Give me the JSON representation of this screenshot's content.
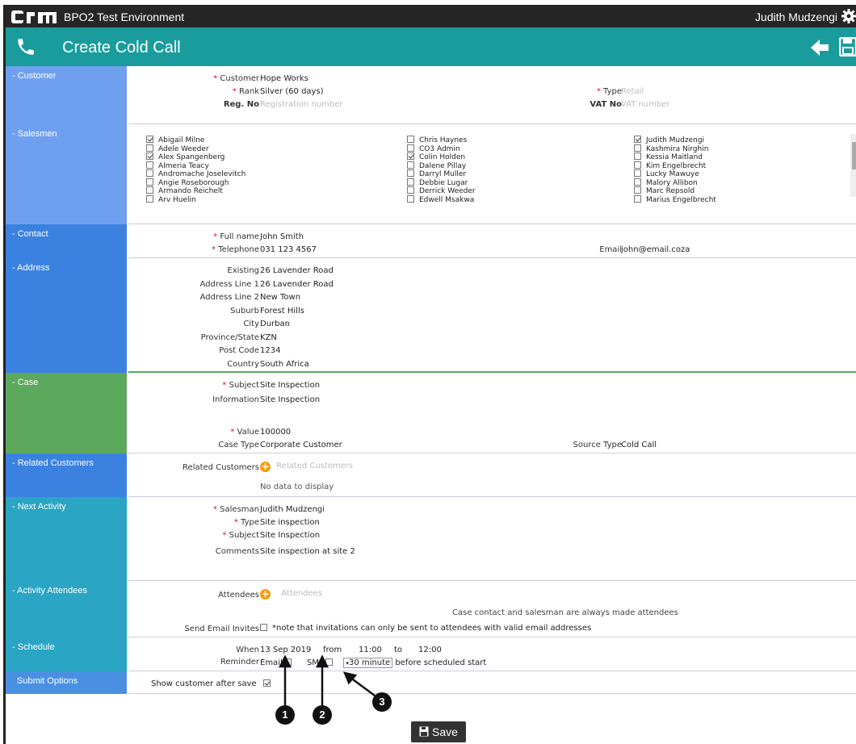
{
  "app": {
    "env_name": "BPO2 Test Environment",
    "user_name": "Judith Mudzengi",
    "page_title": "Create Cold Call"
  },
  "colors": {
    "top_bar": "#262626",
    "title_bar": "#1b9c9c",
    "section_blue": "#4a90e2",
    "section_light_blue": "#6fa0f0",
    "section_green": "#5ca85c",
    "section_teal": "#2aa5c4"
  },
  "sections": {
    "customer": "Customer",
    "salesmen": "Salesmen",
    "contact": "Contact",
    "address": "Address",
    "case": "Case",
    "related": "Related Customers",
    "next_activity": "Next Activity",
    "attendees": "Activity Attendees",
    "schedule": "Schedule",
    "submit": "Submit Options"
  },
  "customer": {
    "customer_label": "Customer",
    "customer_value": "Hope Works",
    "rank_label": "Rank",
    "rank_value": "Silver (60 days)",
    "reg_label": "Reg. No",
    "reg_placeholder": "Registration number",
    "type_label": "Type",
    "type_placeholder": "Retail",
    "vat_label": "VAT No",
    "vat_placeholder": "VAT number"
  },
  "salesmen": {
    "col1": [
      {
        "name": "Abigail Milne",
        "checked": true
      },
      {
        "name": "Adele Weeder",
        "checked": false
      },
      {
        "name": "Alex Spangenberg",
        "checked": true
      },
      {
        "name": "Almeria Teacy",
        "checked": false
      },
      {
        "name": "Andromache Joselevitch",
        "checked": false
      },
      {
        "name": "Angie Roseborough",
        "checked": false
      },
      {
        "name": "Armando Reichelt",
        "checked": false
      },
      {
        "name": "Arv Huelin",
        "checked": false
      }
    ],
    "col2": [
      {
        "name": "Chris Haynes",
        "checked": false
      },
      {
        "name": "CO3 Admin",
        "checked": false
      },
      {
        "name": "Colin Holden",
        "checked": true
      },
      {
        "name": "Dalene Pillay",
        "checked": false
      },
      {
        "name": "Darryl Muller",
        "checked": false
      },
      {
        "name": "Debbie Lugar",
        "checked": false
      },
      {
        "name": "Derrick Weeder",
        "checked": false
      },
      {
        "name": "Edwell Msakwa",
        "checked": false
      }
    ],
    "col3": [
      {
        "name": "Judith Mudzengi",
        "checked": true
      },
      {
        "name": "Kashmira Nirghin",
        "checked": false
      },
      {
        "name": "Kessia Maitland",
        "checked": false
      },
      {
        "name": "Kim Engelbrecht",
        "checked": false
      },
      {
        "name": "Lucky Mawuye",
        "checked": false
      },
      {
        "name": "Malory Allibon",
        "checked": false
      },
      {
        "name": "Marc Repsold",
        "checked": false
      },
      {
        "name": "Marius Engelbrecht",
        "checked": false
      }
    ]
  },
  "contact": {
    "fullname_label": "Full name",
    "fullname_value": "John Smith",
    "telephone_label": "Telephone",
    "telephone_value": "031 123 4567",
    "email_label": "Email",
    "email_value": "john@email.coza"
  },
  "address": {
    "rows": [
      {
        "label": "Existing",
        "value": "26 Lavender Road"
      },
      {
        "label": "Address Line 1",
        "value": "26 Lavender Road"
      },
      {
        "label": "Address Line 2",
        "value": "New Town"
      },
      {
        "label": "Suburb",
        "value": "Forest Hills"
      },
      {
        "label": "City",
        "value": "Durban"
      },
      {
        "label": "Province/State",
        "value": "KZN"
      },
      {
        "label": "Post Code",
        "value": "1234"
      },
      {
        "label": "Country",
        "value": "South Africa"
      }
    ]
  },
  "case": {
    "subject_label": "Subject",
    "subject_value": "Site Inspection",
    "info_label": "Information",
    "info_value": "Site Inspection",
    "value_label": "Value",
    "value_value": "100000",
    "casetype_label": "Case Type",
    "casetype_value": "Corporate Customer",
    "source_label": "Source Type",
    "source_value": "Cold Call"
  },
  "related": {
    "label": "Related Customers",
    "placeholder": "Related Customers",
    "empty": "No data to display"
  },
  "next_activity": {
    "salesman_label": "Salesman",
    "salesman_value": "Judith Mudzengi",
    "type_label": "Type",
    "type_value": "Site inspection",
    "subject_label": "Subject",
    "subject_value": "Site Inspection",
    "comments_label": "Comments",
    "comments_value": "Site inspection at site 2"
  },
  "attendees": {
    "label": "Attendees",
    "placeholder": "Attendees",
    "note": "Case contact and salesman are always made attendees",
    "invite_label": "Send Email Invites",
    "invite_note": "*note that invitations can only be sent to attendees with valid email addresses"
  },
  "schedule": {
    "when_label": "When",
    "date": "13 Sep 2019",
    "from_label": "from",
    "from_time": "11:00",
    "to_label": "to",
    "to_time": "12:00",
    "reminder_label": "Reminder",
    "email_label": "Email",
    "sms_label": "SMS",
    "minutes_value": "30 minute",
    "suffix": "before scheduled start"
  },
  "submit": {
    "label": "Show customer after save",
    "checked": true
  },
  "save_button": "Save",
  "callouts": [
    "1",
    "2",
    "3"
  ]
}
